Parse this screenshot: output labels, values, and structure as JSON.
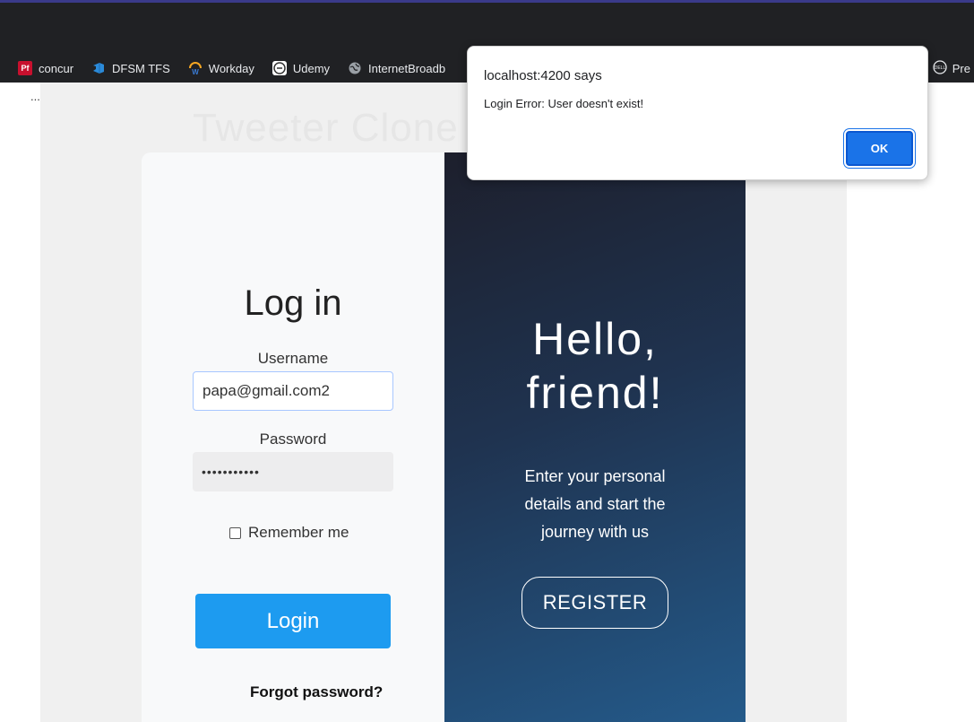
{
  "bookmarks": [
    {
      "label": "concur",
      "icon": "pf-icon",
      "badge": "Pf"
    },
    {
      "label": "DFSM TFS",
      "icon": "devops-icon",
      "badge": ""
    },
    {
      "label": "Workday",
      "icon": "workday-icon",
      "badge": ""
    },
    {
      "label": "Udemy",
      "icon": "udemy-icon",
      "badge": ""
    },
    {
      "label": "InternetBroadb",
      "icon": "globe-icon",
      "badge": ""
    }
  ],
  "bookmarks_right": {
    "label": "Pre",
    "icon": "dell-icon"
  },
  "page": {
    "ellipsis": "...",
    "faded_title": "Tweeter Clone"
  },
  "login": {
    "title": "Log in",
    "username_label": "Username",
    "username_value": "papa@gmail.com2",
    "password_label": "Password",
    "password_value": "•••••••••••",
    "remember_label": "Remember me",
    "login_button": "Login",
    "forgot_link": "Forgot password?"
  },
  "register_panel": {
    "hello_line1": "Hello,",
    "hello_line2": "friend!",
    "message_line1": "Enter your personal",
    "message_line2": "details and start the",
    "message_line3": "journey with us",
    "register_button": "REGISTER"
  },
  "dialog": {
    "title": "localhost:4200 says",
    "message": "Login Error: User doesn't exist!",
    "ok_button": "OK"
  },
  "colors": {
    "accent": "#1d9bf0",
    "dialog_button": "#1a73e8",
    "browser_chrome": "#202124"
  }
}
